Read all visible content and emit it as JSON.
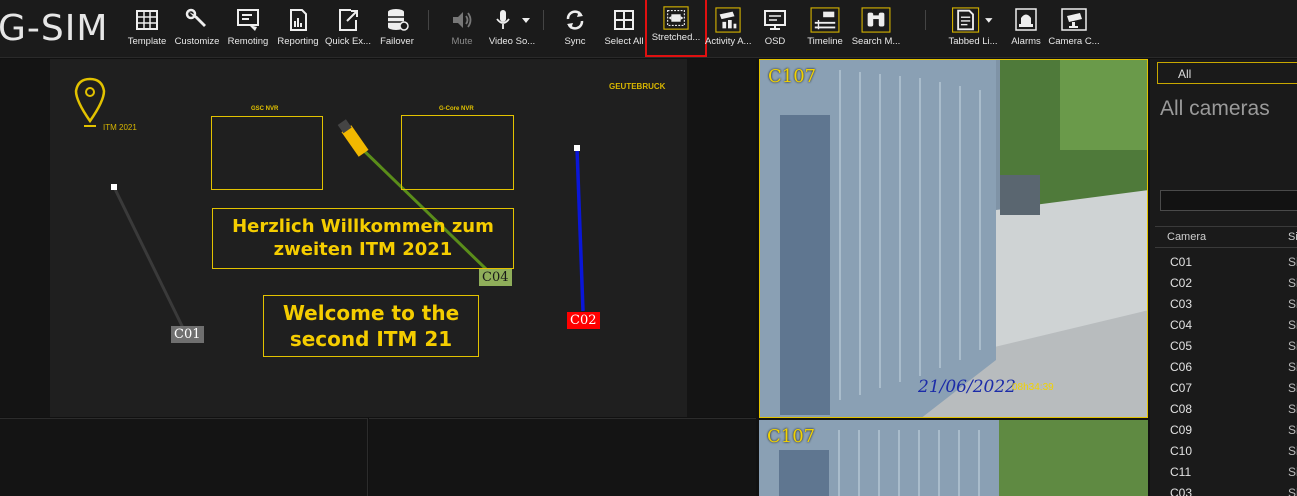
{
  "app": {
    "title": "G-SIM"
  },
  "toolbar": {
    "template": "Template",
    "customize": "Customize",
    "remoting": "Remoting",
    "reporting": "Reporting",
    "quick_export": "Quick Ex...",
    "failover": "Failover",
    "mute": "Mute",
    "video_source": "Video So...",
    "sync": "Sync",
    "select_all": "Select All",
    "stretched": "Stretched...",
    "activity": "Activity A...",
    "osd": "OSD",
    "timeline": "Timeline",
    "search": "Search M...",
    "tabbed": "Tabbed Li...",
    "alarms": "Alarms",
    "camera_c": "Camera C..."
  },
  "map": {
    "logo_text": "ITM 2021",
    "brand": "GEUTEBRUCK",
    "nvr1": "GSC NVR",
    "nvr2": "G-Core NVR",
    "banner_de_line1": "Herzlich Willkommen zum",
    "banner_de_line2": "zweiten ITM 2021",
    "banner_en_line1": "Welcome to the",
    "banner_en_line2": "second ITM 21",
    "cameras": [
      {
        "label": "C01",
        "color": "#6f6f6f",
        "text_color": "#ffffff"
      },
      {
        "label": "C04",
        "color": "#8fae5a",
        "text_color": "#1a1a1a"
      },
      {
        "label": "C02",
        "color": "#ff0000",
        "text_color": "#ffffff"
      }
    ]
  },
  "video": {
    "top": {
      "label": "C107",
      "date": "21/06/2022",
      "time": "08h34:39"
    },
    "bottom": {
      "label": "C107"
    }
  },
  "panel": {
    "tab": "All",
    "title": "All cameras",
    "search_placeholder": "",
    "col_camera": "Camera",
    "col_status": "Si",
    "rows": [
      {
        "camera": "C01",
        "status": "Si"
      },
      {
        "camera": "C02",
        "status": "Si"
      },
      {
        "camera": "C03",
        "status": "Si"
      },
      {
        "camera": "C04",
        "status": "Si"
      },
      {
        "camera": "C05",
        "status": "Si"
      },
      {
        "camera": "C06",
        "status": "Si"
      },
      {
        "camera": "C07",
        "status": "Si"
      },
      {
        "camera": "C08",
        "status": "Si"
      },
      {
        "camera": "C09",
        "status": "Si"
      },
      {
        "camera": "C10",
        "status": "Si"
      },
      {
        "camera": "C11",
        "status": "Si"
      },
      {
        "camera": "C03",
        "status": "Si"
      }
    ]
  },
  "colors": {
    "accent": "#e2c200",
    "selection": "#e01010"
  }
}
